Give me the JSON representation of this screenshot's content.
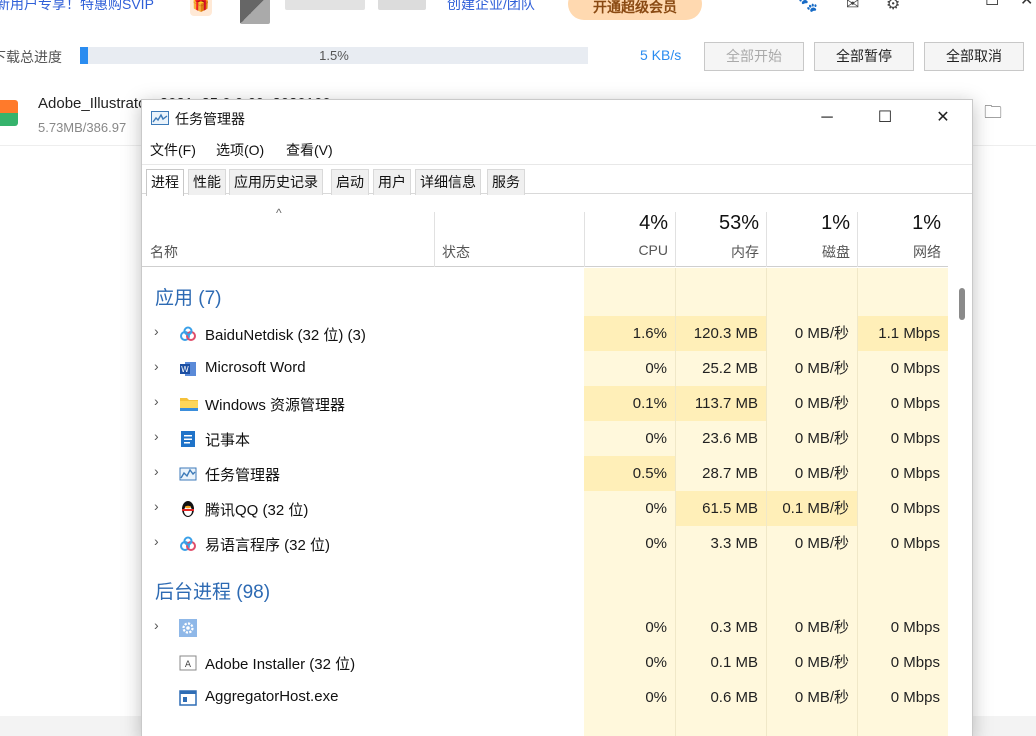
{
  "background_app": {
    "promo_text": "新用户专享！特惠购SVIP",
    "create_team": "创建企业/团队",
    "vip_button": "开通超级会员",
    "progress_label": "下载总进度",
    "progress_text": "1.5%",
    "progress_fraction": 0.015,
    "speed": "5 KB/s",
    "btn_start_all": "全部开始",
    "btn_pause_all": "全部暂停",
    "btn_cancel_all": "全部取消",
    "file_name": "Adobe_Illustrator_2021_25.0.0.60_2020100",
    "file_size": "5.73MB/386.97"
  },
  "task_manager": {
    "title": "任务管理器",
    "menu": [
      "文件(F)",
      "选项(O)",
      "查看(V)"
    ],
    "tabs": [
      "进程",
      "性能",
      "应用历史记录",
      "启动",
      "用户",
      "详细信息",
      "服务"
    ],
    "columns": {
      "name": "名称",
      "status": "状态",
      "cpu_pct": "4%",
      "cpu": "CPU",
      "mem_pct": "53%",
      "mem": "内存",
      "disk_pct": "1%",
      "disk": "磁盘",
      "net_pct": "1%",
      "net": "网络"
    },
    "groups": {
      "apps": "应用 (7)",
      "background": "后台进程 (98)"
    },
    "app_rows": [
      {
        "name": "BaiduNetdisk (32 位) (3)",
        "cpu": "1.6%",
        "mem": "120.3 MB",
        "disk": "0 MB/秒",
        "net": "1.1 Mbps"
      },
      {
        "name": "Microsoft Word",
        "cpu": "0%",
        "mem": "25.2 MB",
        "disk": "0 MB/秒",
        "net": "0 Mbps"
      },
      {
        "name": "Windows 资源管理器",
        "cpu": "0.1%",
        "mem": "113.7 MB",
        "disk": "0 MB/秒",
        "net": "0 Mbps"
      },
      {
        "name": "记事本",
        "cpu": "0%",
        "mem": "23.6 MB",
        "disk": "0 MB/秒",
        "net": "0 Mbps"
      },
      {
        "name": "任务管理器",
        "cpu": "0.5%",
        "mem": "28.7 MB",
        "disk": "0 MB/秒",
        "net": "0 Mbps"
      },
      {
        "name": "腾讯QQ (32 位)",
        "cpu": "0%",
        "mem": "61.5 MB",
        "disk": "0.1 MB/秒",
        "net": "0 Mbps"
      },
      {
        "name": "易语言程序 (32 位)",
        "cpu": "0%",
        "mem": "3.3 MB",
        "disk": "0 MB/秒",
        "net": "0 Mbps"
      }
    ],
    "bg_rows": [
      {
        "name": "",
        "cpu": "0%",
        "mem": "0.3 MB",
        "disk": "0 MB/秒",
        "net": "0 Mbps"
      },
      {
        "name": "Adobe Installer (32 位)",
        "cpu": "0%",
        "mem": "0.1 MB",
        "disk": "0 MB/秒",
        "net": "0 Mbps"
      },
      {
        "name": "AggregatorHost.exe",
        "cpu": "0%",
        "mem": "0.6 MB",
        "disk": "0 MB/秒",
        "net": "0 Mbps"
      }
    ],
    "colors": {
      "heat_light": "#fff8dc",
      "heat_mid": "#ffefb8",
      "group_blue": "#2d6ab3"
    }
  }
}
